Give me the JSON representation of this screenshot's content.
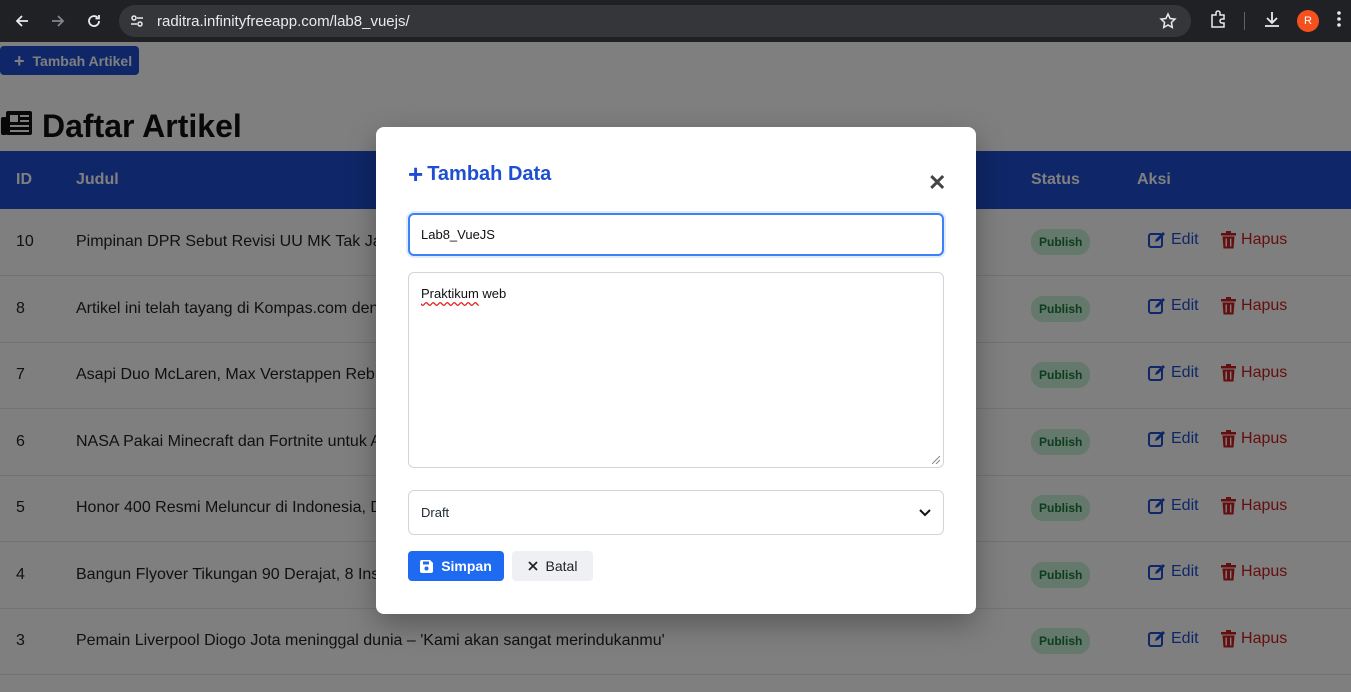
{
  "browser": {
    "url": "raditra.infinityfreeapp.com/lab8_vuejs/",
    "profile_initial": "R"
  },
  "page": {
    "add_button_label": "Tambah Artikel",
    "title": "Daftar Artikel",
    "columns": [
      "ID",
      "Judul",
      "Status",
      "Aksi"
    ],
    "rows": [
      {
        "id": "10",
        "judul": "Pimpinan DPR Sebut Revisi UU MK Tak Jadi",
        "status": "Publish"
      },
      {
        "id": "8",
        "judul": "Artikel ini telah tayang di Kompas.com den",
        "status": "Publish"
      },
      {
        "id": "7",
        "judul": "Asapi Duo McLaren, Max Verstappen Rebut",
        "status": "Publish"
      },
      {
        "id": "6",
        "judul": "NASA Pakai Minecraft dan Fortnite untuk A",
        "status": "Publish"
      },
      {
        "id": "5",
        "judul": "Honor 400 Resmi Meluncur di Indonesia, D",
        "status": "Publish"
      },
      {
        "id": "4",
        "judul": "Bangun Flyover Tikungan 90 Derajat, 8 Insi",
        "status": "Publish"
      },
      {
        "id": "3",
        "judul": "Pemain Liverpool Diogo Jota meninggal dunia – 'Kami akan sangat merindukanmu'",
        "status": "Publish"
      }
    ],
    "edit_label": "Edit",
    "delete_label": "Hapus"
  },
  "modal": {
    "title": "Tambah Data",
    "close_glyph": "✕",
    "title_input_value": "Lab8_VueJS",
    "body_text_underlined": "Praktikum",
    "body_text_rest": " web",
    "status_selected": "Draft",
    "save_label": "Simpan",
    "cancel_label": "Batal"
  },
  "colors": {
    "primary": "#1e4fd1",
    "danger": "#c81e1e",
    "badge_bg": "#c8f0d6",
    "badge_text": "#1a7a3d"
  }
}
